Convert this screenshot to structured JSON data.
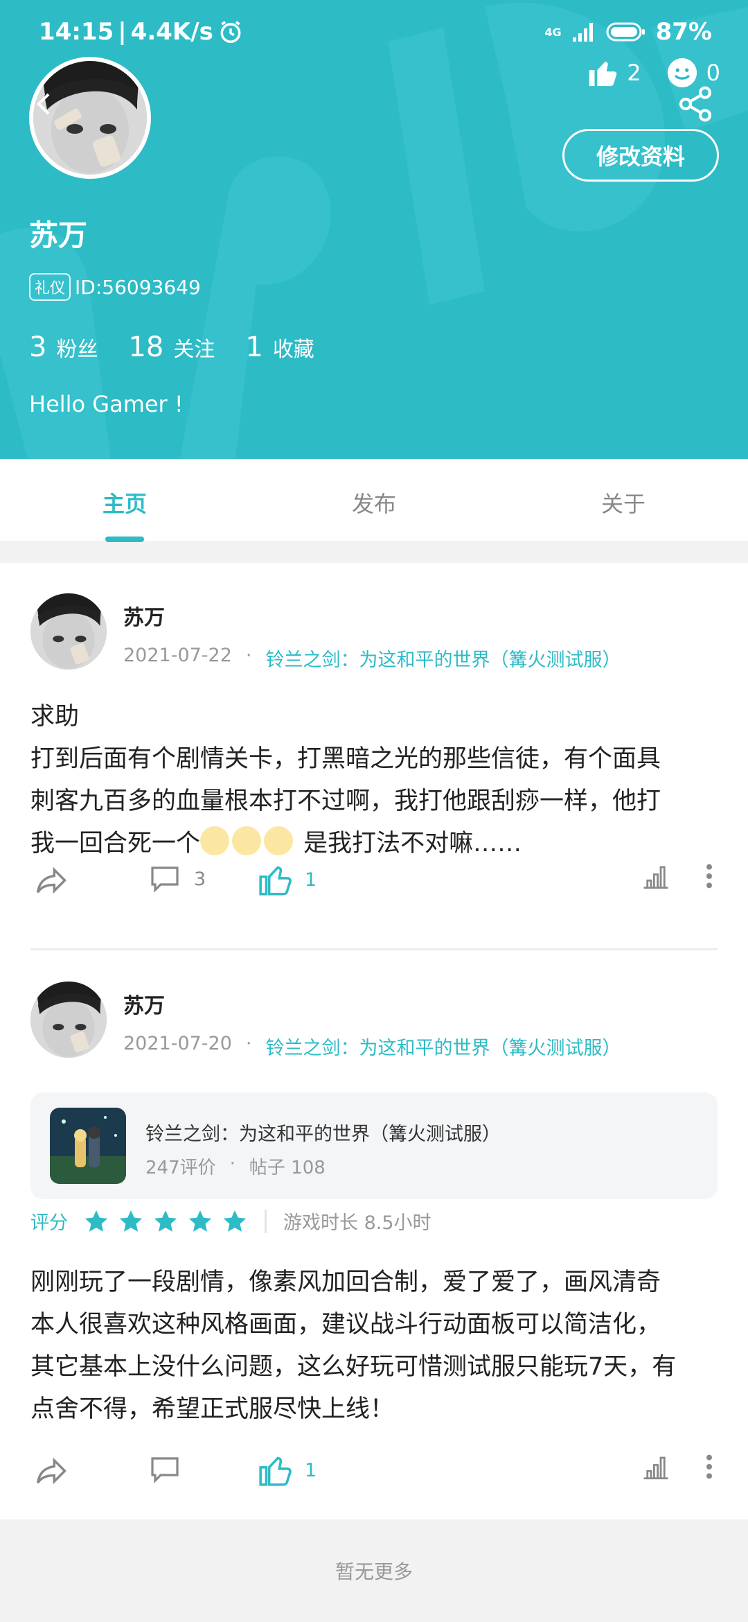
{
  "status_bar": {
    "time": "14:15",
    "net_speed": "4.4K/s",
    "network": "4G",
    "battery": "87%"
  },
  "profile": {
    "likes": "2",
    "emoji_count": "0",
    "edit_label": "修改资料",
    "name": "苏万",
    "badge": "礼仪",
    "id_text": "ID:56093649",
    "fans_num": "3",
    "fans_label": "粉丝",
    "follow_num": "18",
    "follow_label": "关注",
    "fav_num": "1",
    "fav_label": "收藏",
    "bio": "Hello Gamer !"
  },
  "tabs": [
    "主页",
    "发布",
    "关于"
  ],
  "posts": [
    {
      "author": "苏万",
      "date": "2021-07-22",
      "dot": "·",
      "game": "铃兰之剑：为这和平的世界（篝火测试服）",
      "title": "求助",
      "body1": "打到后面有个剧情关卡，打黑暗之光的那些信徒，有个面具",
      "body2": "刺客九百多的血量根本打不过啊，我打他跟刮痧一样，他打",
      "body3a": "我一回合死一个",
      "body3b": " 是我打法不对嘛……",
      "comments": "3",
      "likes": "1"
    },
    {
      "author": "苏万",
      "date": "2021-07-20",
      "dot": "·",
      "game": "铃兰之剑：为这和平的世界（篝火测试服）",
      "card_title": "铃兰之剑：为这和平的世界（篝火测试服）",
      "card_reviews": "247评价",
      "card_dot": "·",
      "card_posts": "帖子 108",
      "rating_label": "评分",
      "rating_stars": 5,
      "play_time": "游戏时长 8.5小时",
      "body1": "刚刚玩了一段剧情，像素风加回合制，爱了爱了，画风清奇",
      "body2": "本人很喜欢这种风格画面，建议战斗行动面板可以简洁化，",
      "body3": "其它基本上没什么问题，这么好玩可惜测试服只能玩7天，有",
      "body4": "点舍不得，希望正式服尽快上线！",
      "comments": "",
      "likes": "1"
    }
  ],
  "footer": "暂无更多",
  "colors": {
    "accent": "#2dbbc6",
    "muted": "#999999"
  }
}
